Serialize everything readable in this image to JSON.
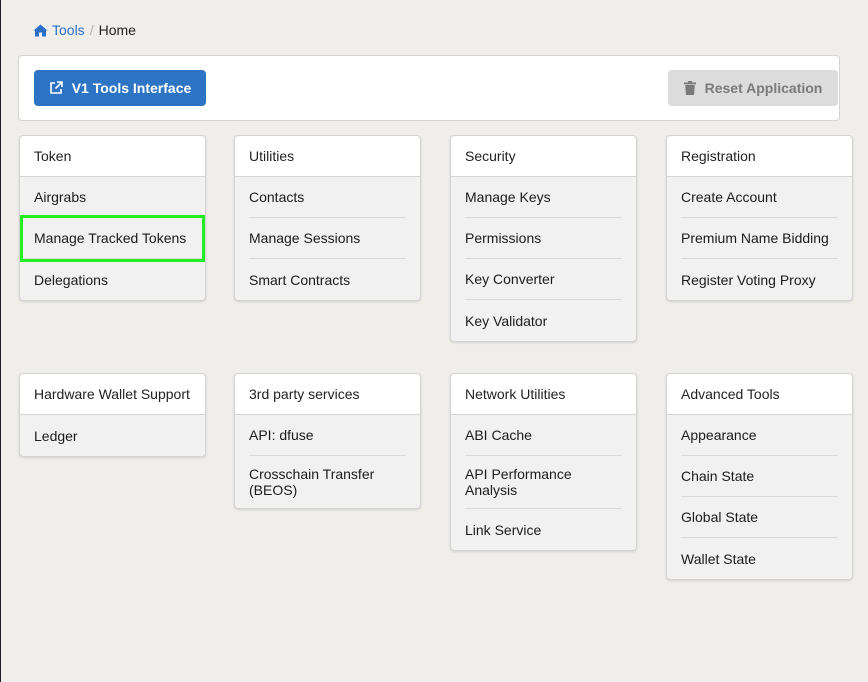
{
  "breadcrumb": {
    "root": "Tools",
    "separator": "/",
    "current": "Home"
  },
  "toolbar": {
    "v1_label": "V1 Tools Interface",
    "reset_label": "Reset Application"
  },
  "cards": [
    {
      "title": "Token",
      "items": [
        "Airgrabs",
        "Manage Tracked Tokens",
        "Delegations"
      ]
    },
    {
      "title": "Utilities",
      "items": [
        "Contacts",
        "Manage Sessions",
        "Smart Contracts"
      ]
    },
    {
      "title": "Security",
      "items": [
        "Manage Keys",
        "Permissions",
        "Key Converter",
        "Key Validator"
      ]
    },
    {
      "title": "Registration",
      "items": [
        "Create Account",
        "Premium Name Bidding",
        "Register Voting Proxy"
      ]
    },
    {
      "title": "Hardware Wallet Support",
      "items": [
        "Ledger"
      ]
    },
    {
      "title": "3rd party services",
      "items": [
        "API: dfuse",
        "Crosschain Transfer (BEOS)"
      ]
    },
    {
      "title": "Network Utilities",
      "items": [
        "ABI Cache",
        "API Performance Analysis",
        "Link Service"
      ]
    },
    {
      "title": "Advanced Tools",
      "items": [
        "Appearance",
        "Chain State",
        "Global State",
        "Wallet State"
      ]
    }
  ]
}
